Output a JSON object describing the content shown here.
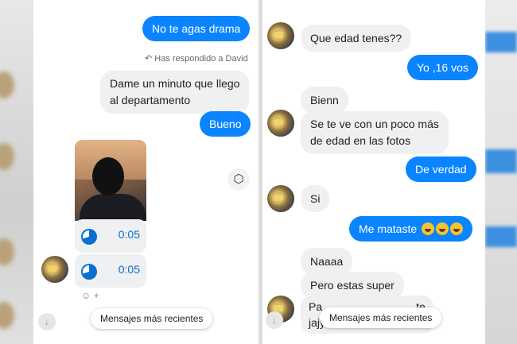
{
  "left": {
    "messages": [
      {
        "text": "No te agas drama"
      },
      {
        "text": "Dame un minuto que llego"
      },
      {
        "text": "al departamento"
      },
      {
        "text": "Bueno"
      }
    ],
    "reply_note": "Has respondido a David",
    "audio": [
      {
        "duration": "0:05"
      },
      {
        "duration": "0:05"
      }
    ],
    "react_text": "+",
    "recent_button": "Mensajes más recientes",
    "share_icon": "share-icon"
  },
  "right": {
    "messages": [
      {
        "text": "Que edad tenes??"
      },
      {
        "text": "Yo ,16 vos"
      },
      {
        "text": "Bienn"
      },
      {
        "text": "Se te ve con un poco más"
      },
      {
        "text": "de edad en las fotos"
      },
      {
        "text": "De verdad"
      },
      {
        "text": "Si"
      },
      {
        "text": "Me mataste"
      },
      {
        "text": "Naaaa"
      },
      {
        "text": "Pero estas super"
      },
      {
        "text": "Pa"
      },
      {
        "text": "te"
      },
      {
        "text": "jajy"
      }
    ],
    "recent_button": "Mensajes más recientes"
  },
  "colors": {
    "outgoing": "#0a84ff",
    "incoming": "#eef0f2",
    "audio": "#0a6fd1"
  }
}
